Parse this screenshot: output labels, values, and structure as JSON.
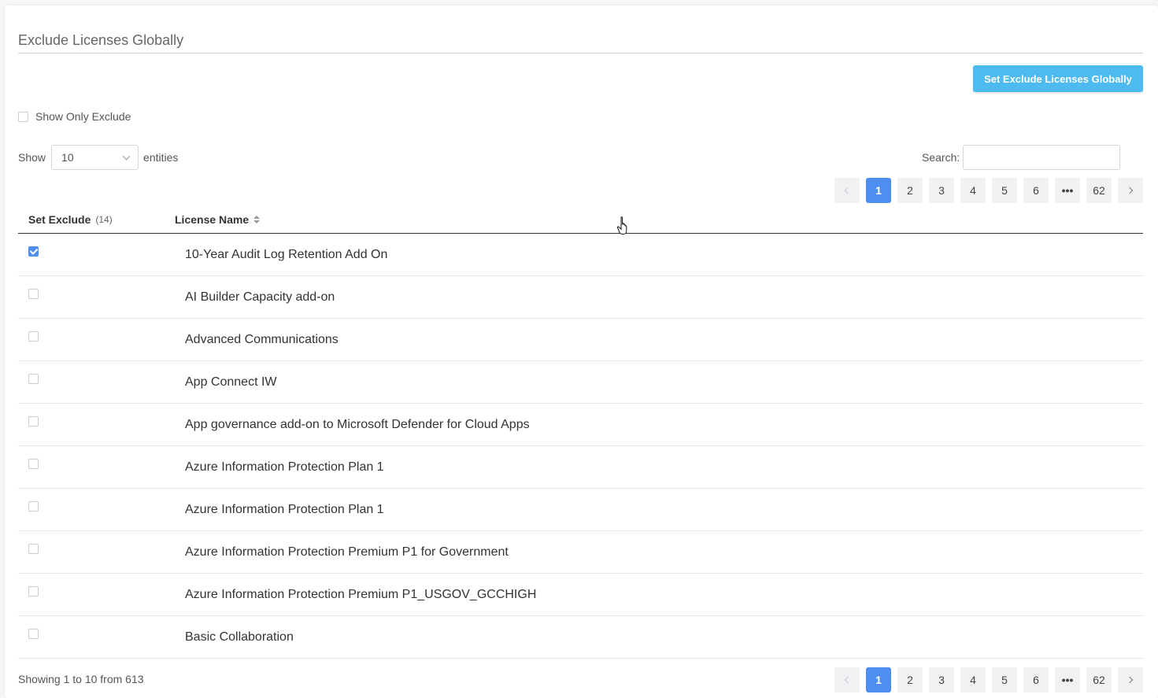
{
  "title": "Exclude Licenses Globally",
  "set_exclude_button": "Set Exclude Licenses Globally",
  "filter": {
    "show_only_exclude_label": "Show Only Exclude",
    "checked": false
  },
  "length": {
    "show_label": "Show",
    "value": "10",
    "entities_label": "entities"
  },
  "search": {
    "label": "Search:",
    "value": ""
  },
  "pagination": {
    "pages": [
      "1",
      "2",
      "3",
      "4",
      "5",
      "6",
      "62"
    ],
    "ellipsis": "•••",
    "current": "1"
  },
  "table": {
    "headers": {
      "set_exclude": "Set Exclude",
      "set_exclude_count": "(14)",
      "license_name": "License Name"
    },
    "rows": [
      {
        "name": "10-Year Audit Log Retention Add On",
        "excluded": true
      },
      {
        "name": "AI Builder Capacity add-on",
        "excluded": false
      },
      {
        "name": "Advanced Communications",
        "excluded": false
      },
      {
        "name": "App Connect IW",
        "excluded": false
      },
      {
        "name": "App governance add-on to Microsoft Defender for Cloud Apps",
        "excluded": false
      },
      {
        "name": "Azure Information Protection Plan 1",
        "excluded": false
      },
      {
        "name": "Azure Information Protection Plan 1",
        "excluded": false
      },
      {
        "name": "Azure Information Protection Premium P1 for Government",
        "excluded": false
      },
      {
        "name": "Azure Information Protection Premium P1_USGOV_GCCHIGH",
        "excluded": false
      },
      {
        "name": "Basic Collaboration",
        "excluded": false
      }
    ]
  },
  "footer": {
    "info": "Showing 1 to 10 from 613"
  },
  "colors": {
    "primary_button": "#4dbbf0",
    "active_page": "#4f8ef0",
    "checkbox_checked": "#4f8ef0"
  }
}
